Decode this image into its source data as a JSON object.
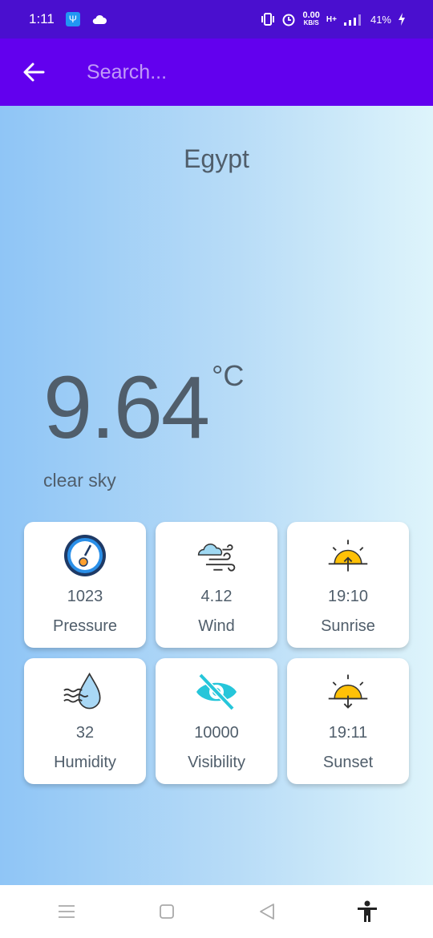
{
  "status_bar": {
    "time": "1:11",
    "net_speed_value": "0.00",
    "net_speed_unit": "KB/S",
    "network": "H+",
    "battery": "41%"
  },
  "search": {
    "placeholder": "Search..."
  },
  "weather": {
    "city": "Egypt",
    "temperature": "9.64",
    "unit": "°C",
    "description": "clear sky"
  },
  "cards": [
    {
      "value": "1023",
      "label": "Pressure",
      "icon": "gauge-icon"
    },
    {
      "value": "4.12",
      "label": "Wind",
      "icon": "wind-icon"
    },
    {
      "value": "19:10",
      "label": "Sunrise",
      "icon": "sunrise-icon"
    },
    {
      "value": "32",
      "label": "Humidity",
      "icon": "humidity-icon"
    },
    {
      "value": "10000",
      "label": "Visibility",
      "icon": "visibility-icon"
    },
    {
      "value": "19:11",
      "label": "Sunset",
      "icon": "sunset-icon"
    }
  ],
  "colors": {
    "app_bar": "#6200ee",
    "status_bar": "#4a0fcf",
    "text": "#505e6b",
    "accent_teal": "#26c6da",
    "sun": "#ffc107"
  }
}
